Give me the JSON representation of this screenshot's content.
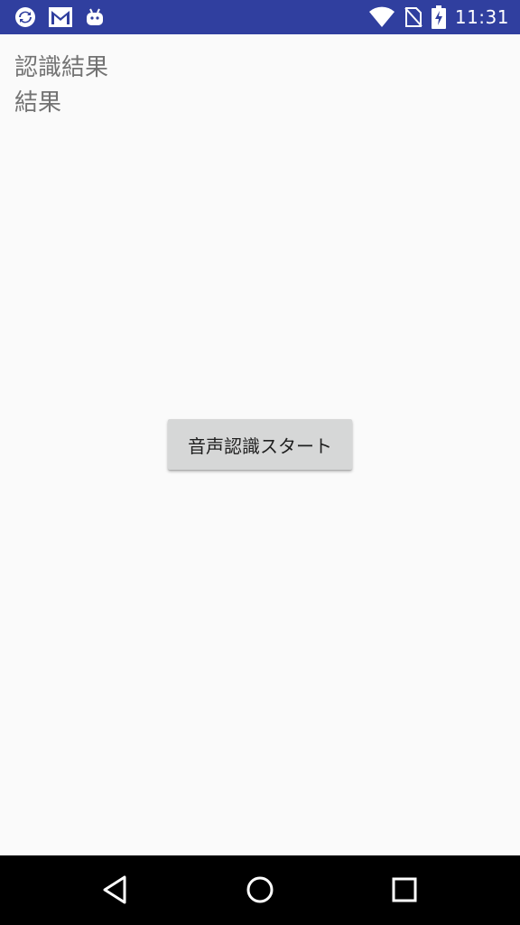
{
  "status_bar": {
    "time": "11:31",
    "background_color": "#303f9f",
    "left_icons": [
      "sync-icon",
      "gmail-icon",
      "android-icon"
    ],
    "right_icons": [
      "wifi-icon",
      "no-sim-icon",
      "battery-charging-icon"
    ]
  },
  "main": {
    "result_label": "認識結果",
    "result_value": "結果",
    "start_button_label": "音声認識スタート"
  },
  "nav_bar": {
    "icons": [
      "back-icon",
      "home-icon",
      "recents-icon"
    ]
  }
}
